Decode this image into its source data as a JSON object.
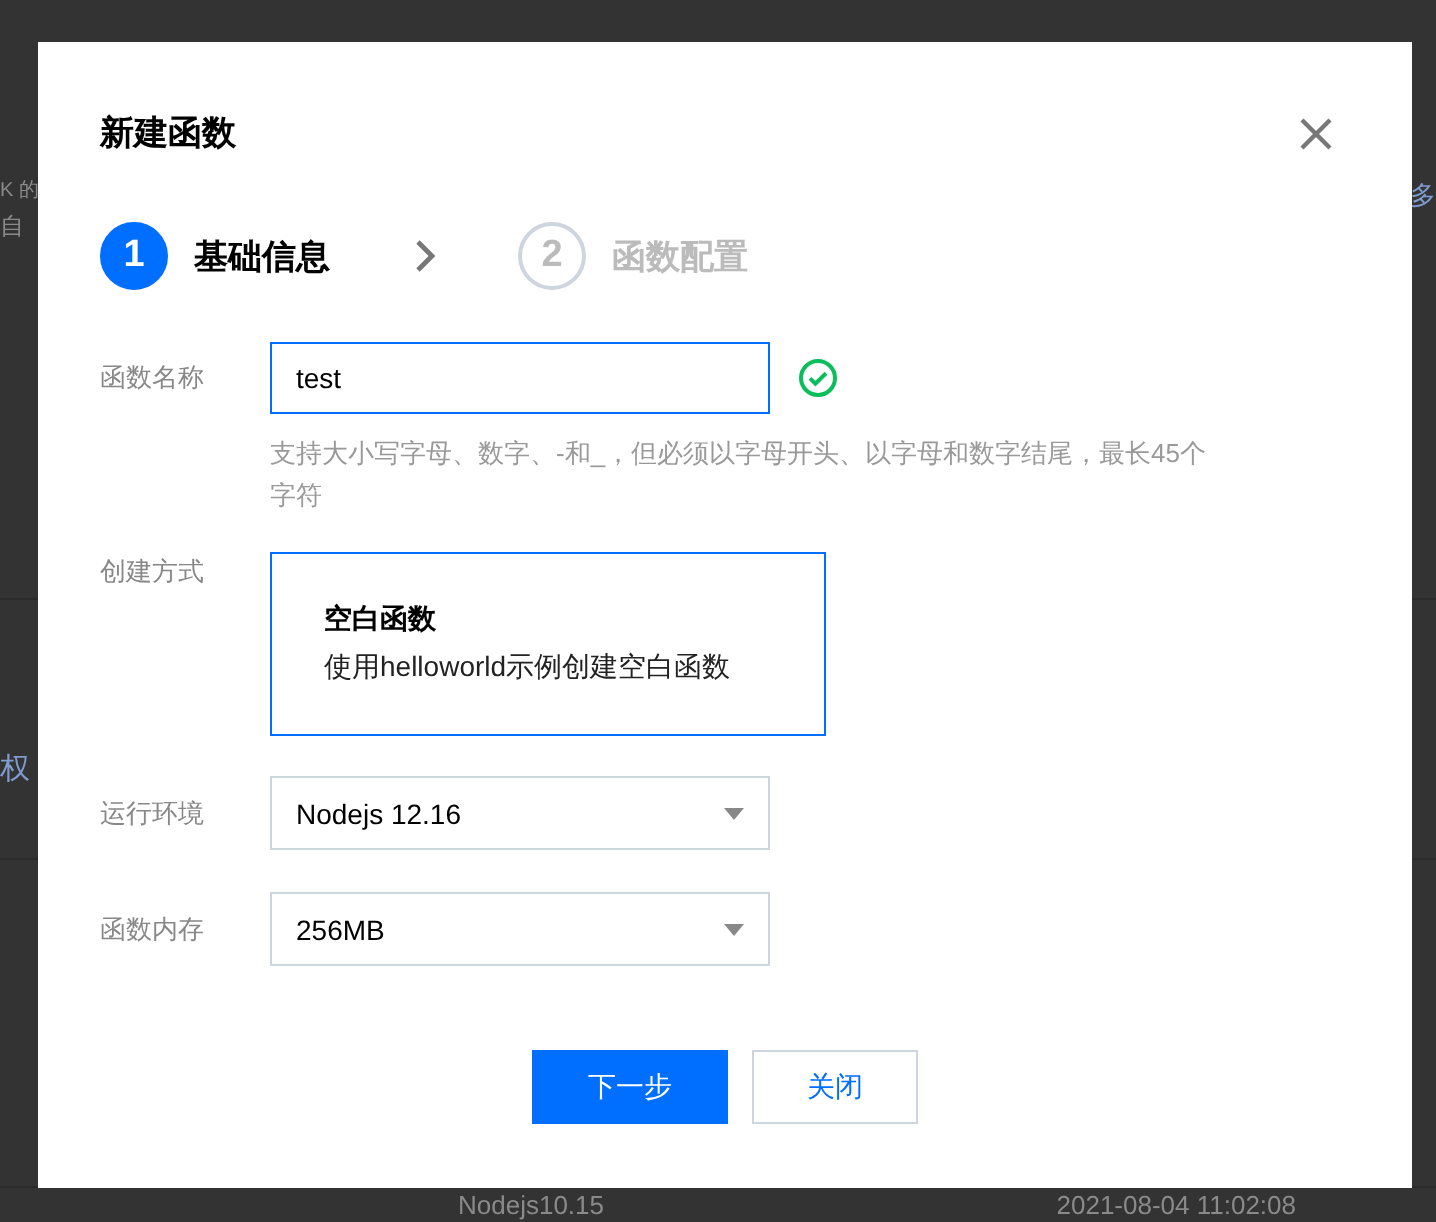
{
  "background_page": {
    "fragments": [
      "K 的",
      "自",
      "多",
      "权",
      "Nodejs10.15",
      "2021-08-04 11:02:08"
    ]
  },
  "dialog": {
    "title": "新建函数"
  },
  "steps": [
    {
      "number": "1",
      "label": "基础信息",
      "selected": true
    },
    {
      "number": "2",
      "label": "函数配置",
      "selected": false
    }
  ],
  "fields": [
    {
      "kind": "input",
      "label": "函数名称",
      "value": "test",
      "valid": true,
      "hint": "支持大小写字母、数字、-和_，但必须以字母开头、以字母和数字结尾，最长45个字符"
    },
    {
      "kind": "card",
      "label": "创建方式",
      "title": "空白函数",
      "description": "使用helloworld示例创建空白函数",
      "selected": true
    },
    {
      "kind": "select",
      "label": "运行环境",
      "value": "Nodejs 12.16"
    },
    {
      "kind": "select",
      "label": "函数内存",
      "value": "256MB"
    }
  ],
  "buttons": [
    {
      "label": "下一步",
      "kind": "primary"
    },
    {
      "label": "关闭",
      "kind": "secondary"
    }
  ]
}
